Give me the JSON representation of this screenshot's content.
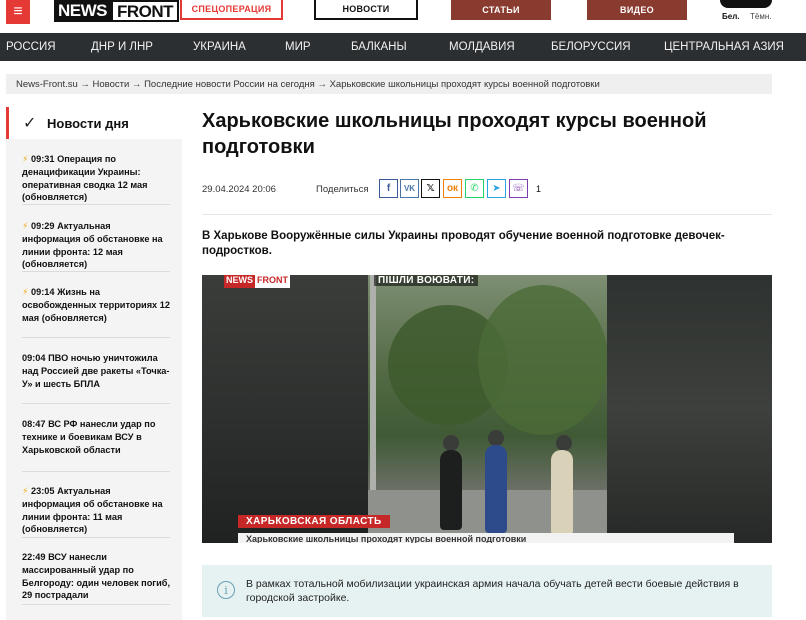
{
  "header": {
    "menu_icon": "hamburger-icon",
    "logo_news": "NEWS",
    "logo_front": "FRONT",
    "buttons": {
      "spec": "СПЕЦОПЕРАЦИЯ",
      "news": "НОВОСТИ",
      "articles": "СТАТЬИ",
      "video": "ВИДЕО"
    },
    "lang_bel": "Бел.",
    "theme_dark": "Тёмн."
  },
  "nav": {
    "items": [
      "РОССИЯ",
      "ДНР И ЛНР",
      "УКРАИНА",
      "МИР",
      "БАЛКАНЫ",
      "МОЛДАВИЯ",
      "БЕЛОРУССИЯ",
      "ЦЕНТРАЛЬНАЯ АЗИЯ"
    ]
  },
  "breadcrumb": "News-Front.su → Новости → Последние новости России на сегодня → Харьковские школьницы проходят курсы военной подготовки",
  "sidebar": {
    "title": "Новости дня",
    "items": [
      {
        "time": "09:31",
        "text": "Операция по денацификации Украины: оперативная сводка 12 мая (обновляется)",
        "flash": true
      },
      {
        "time": "09:29",
        "text": "Актуальная информация об обстановке на линии фронта: 12 мая (обновляется)",
        "flash": true
      },
      {
        "time": "09:14",
        "text": "Жизнь на освобожденных территориях 12 мая (обновляется)",
        "flash": true
      },
      {
        "time": "09:04",
        "text": "ПВО ночью уничтожила над Россией две ракеты «Точка-У» и шесть БПЛА",
        "flash": false
      },
      {
        "time": "08:47",
        "text": "ВС РФ нанесли удар по технике и боевикам ВСУ в Харьковской области",
        "flash": false
      },
      {
        "time": "23:05",
        "text": "Актуальная информация об обстановке на линии фронта: 11 мая (обновляется)",
        "flash": true
      },
      {
        "time": "22:49",
        "text": "ВСУ нанесли массированный удар по Белгороду: один человек погиб, 29 пострадали",
        "flash": false
      }
    ]
  },
  "article": {
    "title": "Харьковские школьницы проходят курсы военной подготовки",
    "date": "29.04.2024 20:06",
    "share_label": "Поделиться",
    "share_count": "1",
    "lead": "В Харькове Вооружённые силы Украины проводят обучение военной подготовке девочек-подростков.",
    "video": {
      "logo_news": "NEWS",
      "logo_front": "FRONT",
      "caption_top": "ПІШЛИ ВОЮВАТИ:",
      "region": "ХАРЬКОВСКАЯ ОБЛАСТЬ",
      "ticker": "Харьковские школьницы проходят курсы военной подготовки"
    },
    "info": "В рамках тотальной мобилизации украинская армия начала обучать детей вести боевые действия в городской застройке."
  },
  "colors": {
    "accent": "#e53935",
    "nav_bg": "#2c2f31",
    "button_dark_red": "#8a3b2f",
    "info_bg": "#e6f2f2"
  }
}
